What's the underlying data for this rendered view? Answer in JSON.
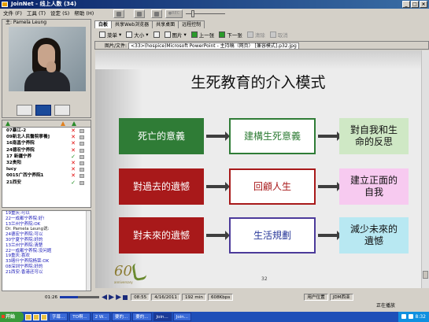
{
  "window": {
    "title": "JoinNet - 线上人数 (34)"
  },
  "menu": [
    "文件 (F)",
    "工具 (T)",
    "设定 (S)",
    "帮助 (H)"
  ],
  "media_toolbar": {
    "rec_label": "●REC",
    "volume_level": 0.15
  },
  "video": {
    "speaker": "主: Pamela Leung"
  },
  "users": [
    {
      "name": "07暴江-2",
      "status": "x"
    },
    {
      "name": "09新北人民醫院寧養]",
      "status": "x"
    },
    {
      "name": "16南昌宁养院",
      "status": "x"
    },
    {
      "name": "24德宏宁养院",
      "status": "x"
    },
    {
      "name": "17 新疆宁养",
      "status": "v"
    },
    {
      "name": "32贵阳",
      "status": "x"
    },
    {
      "name": "lucy",
      "status": "x"
    },
    {
      "name": "0015广西宁养院1",
      "status": "x"
    },
    {
      "name": "21西安",
      "status": "v"
    }
  ],
  "chat": [
    {
      "text": "19重庆:可以",
      "dark": false
    },
    {
      "text": "22一成都宁养院:好!",
      "dark": false
    },
    {
      "text": "13兰州宁养院:OK",
      "dark": false
    },
    {
      "text": "Dr. Pamela Leung说:",
      "dark": true
    },
    {
      "text": "24德宏宁养院:可以",
      "dark": false
    },
    {
      "text": "30宁夏宁养院:好的",
      "dark": false
    },
    {
      "text": "13兰州宁养院:清楚",
      "dark": false
    },
    {
      "text": "22一成都宁养院:没问题",
      "dark": false
    },
    {
      "text": "19重庆:喜欢",
      "dark": false
    },
    {
      "text": "33喀什宁养院杨荣:OK",
      "dark": false
    },
    {
      "text": "08深圳宁养院:好的",
      "dark": false
    },
    {
      "text": "21西安:香港还可以",
      "dark": false
    }
  ],
  "tabs": [
    "白板",
    "共享Web浏览器",
    "共享桌面",
    "远程控制"
  ],
  "toolbar": {
    "menu": "菜单",
    "size": "大小",
    "image": "图片",
    "prev": "上一张",
    "next": "下一张",
    "clear": "清除",
    "cancel": "取消"
  },
  "path": {
    "label": "图片/文件:",
    "value": "<33>(hospice)Microsoft PowerPoint - 主持稿（网页） [兼容模式].p32.jpg"
  },
  "slide": {
    "title": "生死教育的介入模式",
    "rows": [
      [
        "死亡的意義",
        "建構生死意義",
        "對自我和生命的反思"
      ],
      [
        "對過去的遺憾",
        "回顧人生",
        "建立正面的自我"
      ],
      [
        "對未來的遺憾",
        "生活規劃",
        "減少未來的遺憾"
      ]
    ],
    "page_number": "32",
    "anniversary_number": "60",
    "anniversary_text": "anniversary"
  },
  "playback": {
    "time": "01:26",
    "progress": 0.45,
    "clock": "08:55",
    "date": "4/16/2011",
    "duration": "192 min",
    "bitrate": "608Kbps"
  },
  "window_status": {
    "left": "用户位置",
    "right": "JDM西亚",
    "bottom": "正在播放"
  },
  "taskbar": {
    "start": "开始",
    "items": [
      "字幕...",
      "TO啊...",
      "2 W...",
      "要的...",
      "要的...",
      "Join...",
      "Join..."
    ],
    "time": "8:32"
  },
  "colors": {
    "red_box": "#a8191a",
    "green_box": "#2f7c36",
    "purple_box": "#4b3a9a",
    "mint": "#cfe8c5",
    "pink": "#f7caf0",
    "cyan": "#b8e8f2"
  }
}
